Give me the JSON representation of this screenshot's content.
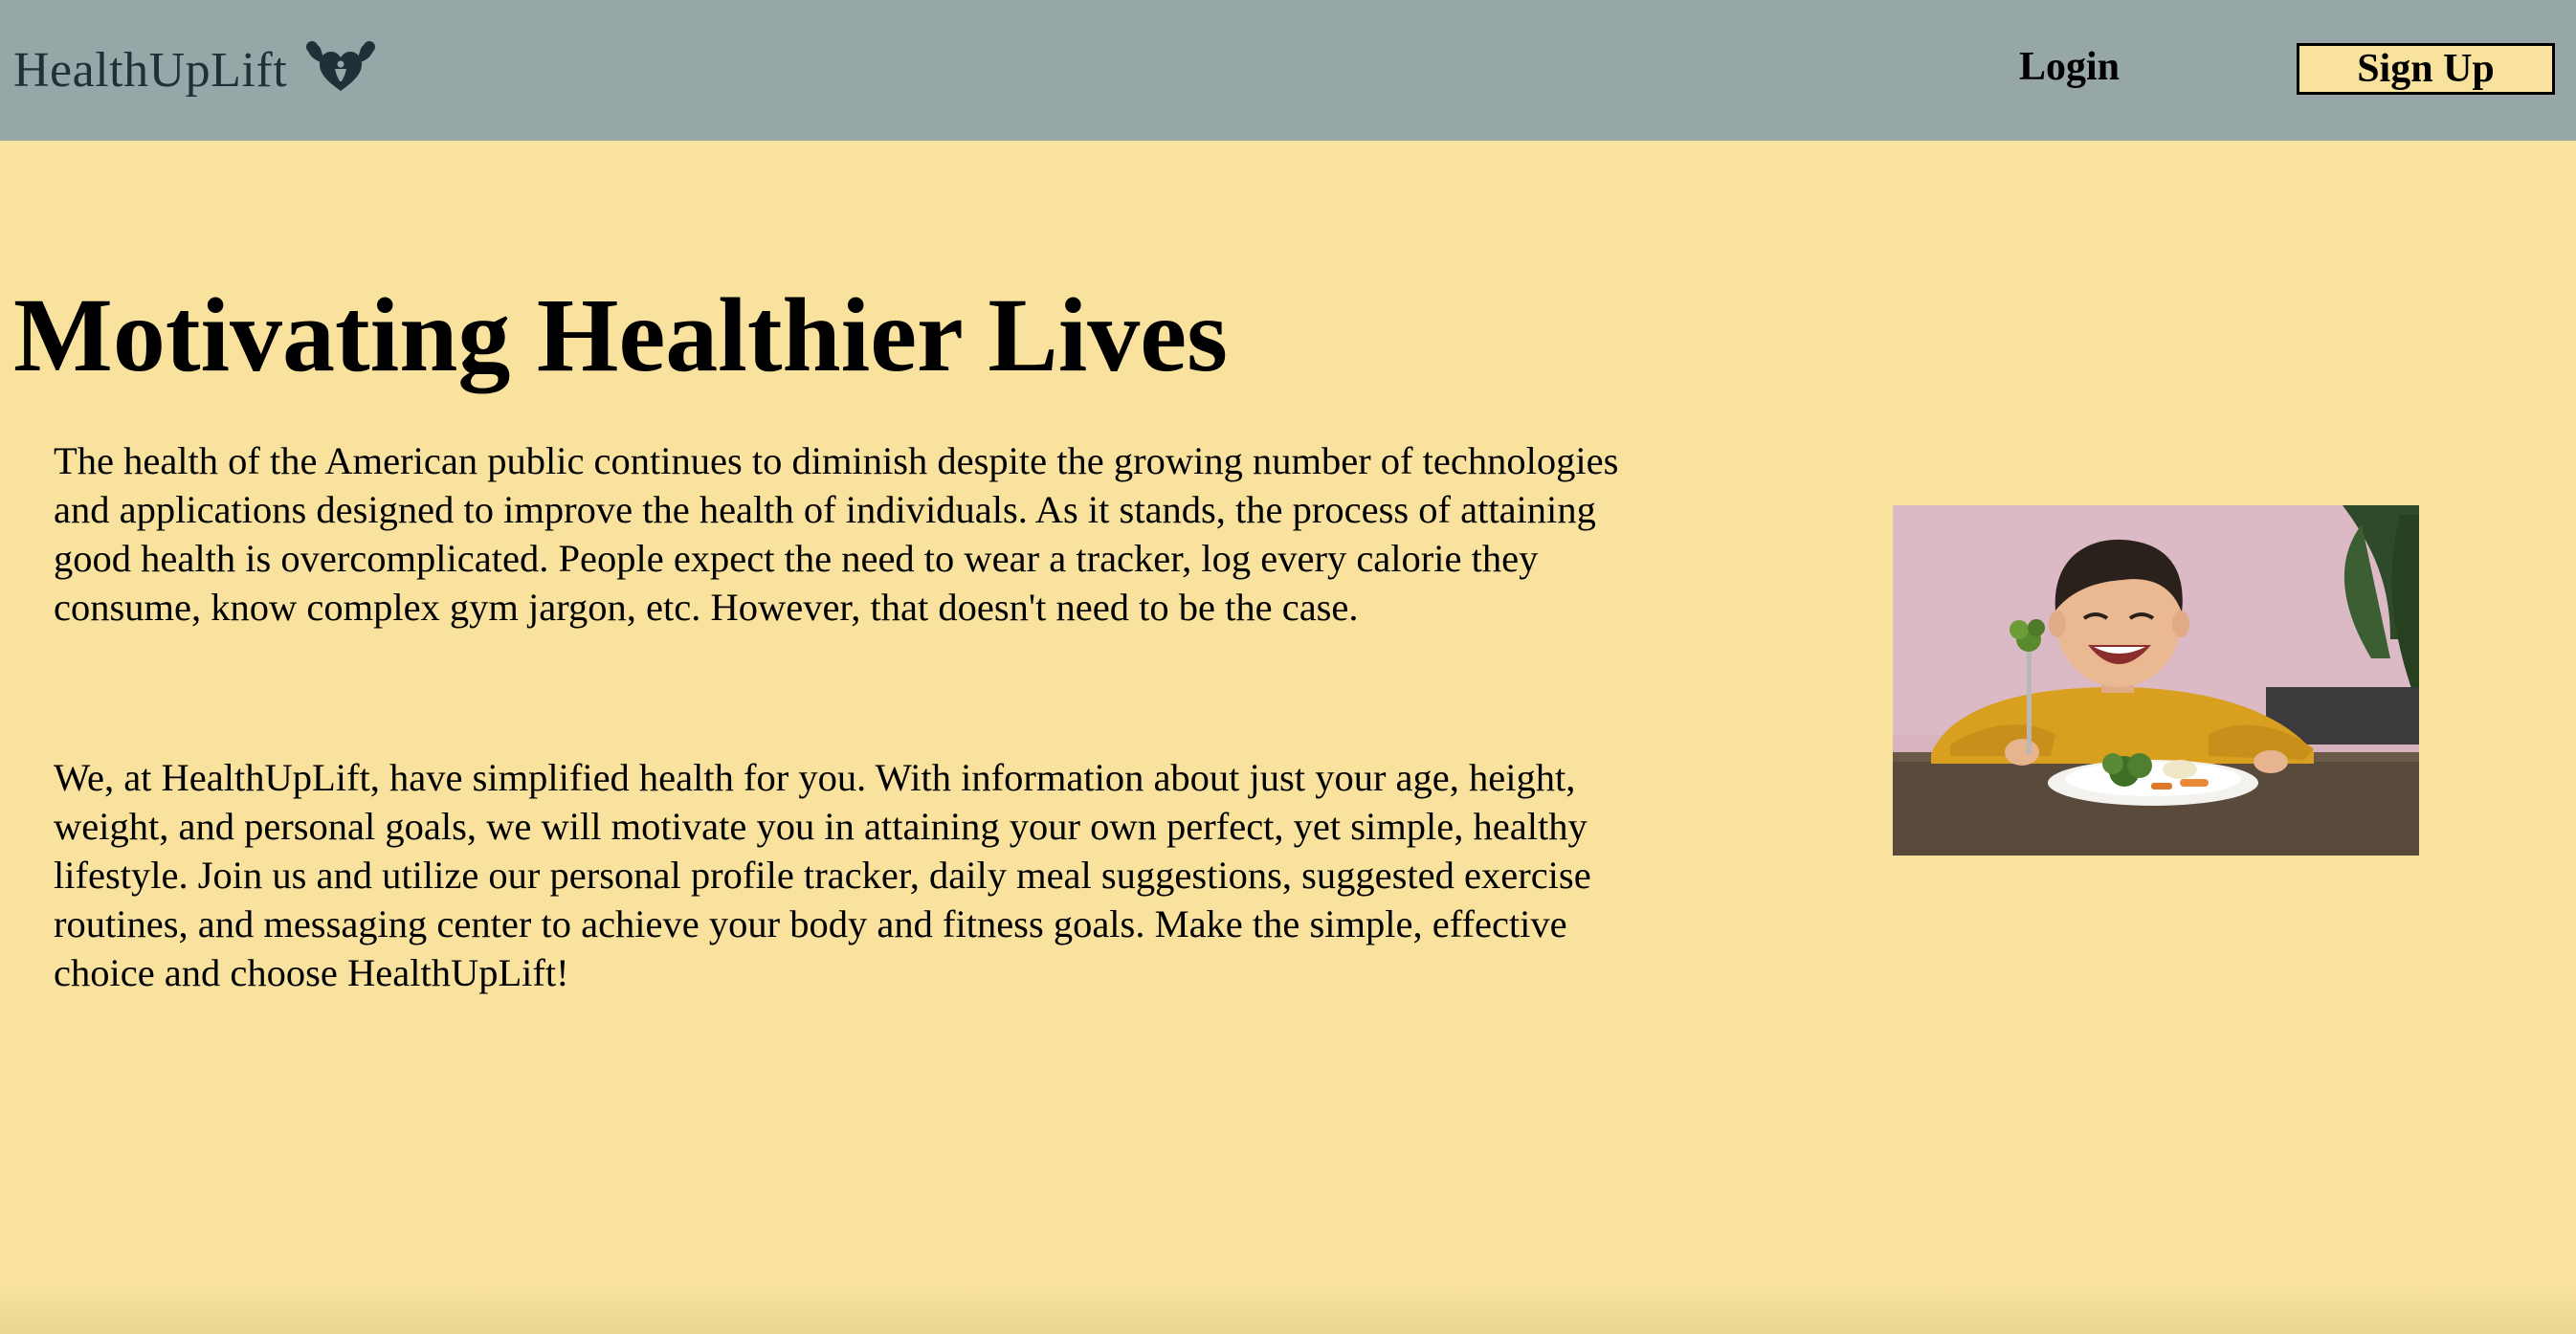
{
  "header": {
    "brand_name": "HealthUpLift",
    "brand_icon": "flexing-arms-heart-icon",
    "login_label": "Login",
    "signup_label": "Sign Up"
  },
  "main": {
    "title": "Motivating Healthier Lives",
    "paragraphs": [
      "The health of the American public continues to diminish despite the growing number of technologies and applications designed to improve the health of individuals. As it stands, the process of attaining good health is overcomplicated. People expect the need to wear a tracker, log every calorie they consume, know complex gym jargon, etc. However, that doesn't need to be the case.",
      "We, at HealthUpLift, have simplified health for you. With information about just your age, height, weight, and personal goals, we will motivate you in attaining your own perfect, yet simple, healthy lifestyle. Join us and utilize our personal profile tracker, daily meal suggestions, suggested exercise routines, and messaging center to achieve your body and fitness goals. Make the simple, effective choice and choose HealthUpLift!"
    ],
    "image_icon": "child-eating-vegetables-photo"
  },
  "colors": {
    "navbar_bg": "#97a6a7",
    "page_bg": "#f8e29e",
    "brand_text": "#1f3138"
  }
}
